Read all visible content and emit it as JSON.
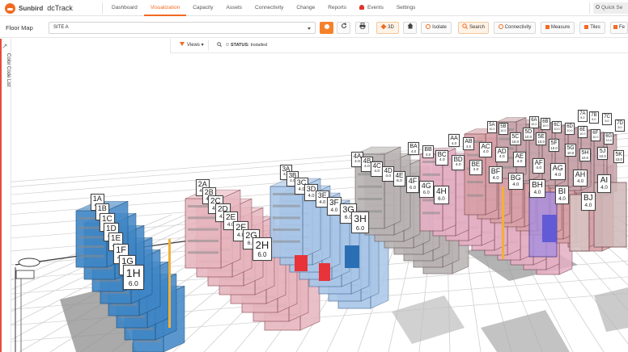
{
  "brand": {
    "name": "Sunbird",
    "product": "dcTrack"
  },
  "nav": {
    "items": [
      {
        "label": "Dashboard",
        "active": false
      },
      {
        "label": "Visualization",
        "active": true
      },
      {
        "label": "Capacity",
        "active": false
      },
      {
        "label": "Assets",
        "active": false
      },
      {
        "label": "Connectivity",
        "active": false
      },
      {
        "label": "Change",
        "active": false
      },
      {
        "label": "Reports",
        "active": false
      },
      {
        "label": "Events",
        "active": false,
        "icon": "bell-icon"
      },
      {
        "label": "Settings",
        "active": false
      }
    ],
    "quick_search_placeholder": "Quick Se"
  },
  "toolbar": {
    "title": "Floor Map",
    "site_value": "SITE A",
    "btn_3d": "3D",
    "btn_isolate": "Isolate",
    "btn_search": "Search",
    "btn_connectivity": "Connectivity",
    "btn_measure": "Measure",
    "btn_tiles": "Tiles",
    "btn_more": "Fe"
  },
  "filters": {
    "views_label": "Views",
    "status_key": "STATUS:",
    "status_value": "Installed"
  },
  "left_panel": {
    "label": "Color Code List"
  },
  "accent_color": "#f26a21",
  "racks": [
    {
      "name": "1A",
      "value": "4.0"
    },
    {
      "name": "1B",
      "value": "4.0"
    },
    {
      "name": "1C",
      "value": "4.0"
    },
    {
      "name": "1D",
      "value": "4.0"
    },
    {
      "name": "1E",
      "value": "4.0"
    },
    {
      "name": "1F",
      "value": "4.0"
    },
    {
      "name": "1G",
      "value": "6.0"
    },
    {
      "name": "1H",
      "value": "6.0"
    },
    {
      "name": "2A",
      "value": "4.0"
    },
    {
      "name": "2B",
      "value": "4.0"
    },
    {
      "name": "2C",
      "value": "4.0"
    },
    {
      "name": "2D",
      "value": "4.0"
    },
    {
      "name": "2E",
      "value": "4.0"
    },
    {
      "name": "2F",
      "value": "4.0"
    },
    {
      "name": "2G",
      "value": "6.0"
    },
    {
      "name": "2H",
      "value": "6.0"
    },
    {
      "name": "3A",
      "value": "4.0"
    },
    {
      "name": "3B",
      "value": "4.0"
    },
    {
      "name": "3C",
      "value": "4.0"
    },
    {
      "name": "3D",
      "value": "4.0"
    },
    {
      "name": "3E",
      "value": "4.0"
    },
    {
      "name": "3F",
      "value": "4.0"
    },
    {
      "name": "3G",
      "value": "6.0"
    },
    {
      "name": "3H",
      "value": "6.0"
    },
    {
      "name": "4A",
      "value": "4.0"
    },
    {
      "name": "4B",
      "value": "4.0"
    },
    {
      "name": "4C",
      "value": "4.0"
    },
    {
      "name": "4D",
      "value": "4.0"
    },
    {
      "name": "4E",
      "value": "6.0"
    },
    {
      "name": "4F",
      "value": "6.0"
    },
    {
      "name": "4G",
      "value": "6.0"
    },
    {
      "name": "4H",
      "value": "6.0"
    },
    {
      "name": "BA",
      "value": "4.0"
    },
    {
      "name": "BB",
      "value": "4.0"
    },
    {
      "name": "BC",
      "value": "4.0"
    },
    {
      "name": "BD",
      "value": "4.0"
    },
    {
      "name": "BE",
      "value": "4.0"
    },
    {
      "name": "BF",
      "value": "4.0"
    },
    {
      "name": "BG",
      "value": "4.0"
    },
    {
      "name": "BH",
      "value": "4.0"
    },
    {
      "name": "BI",
      "value": "4.0"
    },
    {
      "name": "BJ",
      "value": "4.0"
    },
    {
      "name": "AA",
      "value": "4.0"
    },
    {
      "name": "AB",
      "value": "4.0"
    },
    {
      "name": "AC",
      "value": "4.0"
    },
    {
      "name": "AD",
      "value": "4.0"
    },
    {
      "name": "AE",
      "value": "4.0"
    },
    {
      "name": "AF",
      "value": "4.0"
    },
    {
      "name": "AG",
      "value": "4.0"
    },
    {
      "name": "AH",
      "value": "4.0"
    },
    {
      "name": "AI",
      "value": "4.0"
    },
    {
      "name": "5A",
      "value": "10.0"
    },
    {
      "name": "5B",
      "value": "10.0"
    },
    {
      "name": "5C",
      "value": "10.0"
    },
    {
      "name": "5D",
      "value": "10.0"
    },
    {
      "name": "5E",
      "value": "10.0"
    },
    {
      "name": "5F",
      "value": "10.0"
    },
    {
      "name": "5G",
      "value": "10.0"
    },
    {
      "name": "5H",
      "value": "10.0"
    },
    {
      "name": "6A",
      "value": "10.0"
    },
    {
      "name": "6B",
      "value": "10.0"
    },
    {
      "name": "6C",
      "value": "10.0"
    },
    {
      "name": "6D",
      "value": "10.0"
    },
    {
      "name": "6E",
      "value": "10.0"
    },
    {
      "name": "6F",
      "value": "10.0"
    },
    {
      "name": "6G",
      "value": "10.0"
    },
    {
      "name": "7A",
      "value": "5.0"
    },
    {
      "name": "7B",
      "value": "5.0"
    },
    {
      "name": "7C",
      "value": "5.0"
    },
    {
      "name": "7D",
      "value": "5.0"
    },
    {
      "name": "5J",
      "value": "10.0"
    },
    {
      "name": "5K",
      "value": "10.0"
    }
  ]
}
